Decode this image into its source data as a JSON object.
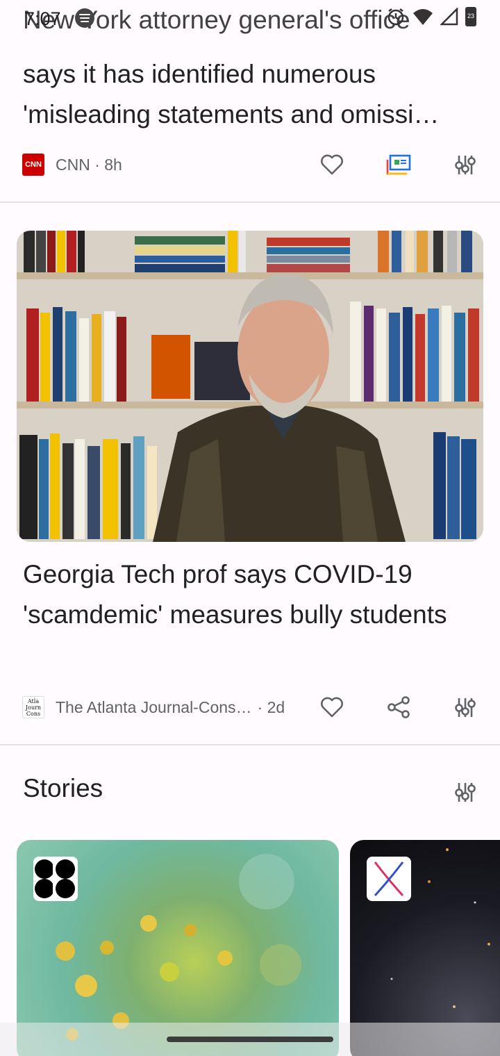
{
  "status_bar": {
    "time": "7:07",
    "icons": [
      "spotify-icon",
      "alarm-icon",
      "wifi-icon",
      "signal-icon",
      "battery-icon"
    ],
    "battery_level": "23"
  },
  "card1": {
    "headline_top": "New York attorney general's office",
    "headline_line2": "says it has identified numerous",
    "headline_line3": "'misleading statements and omissi…",
    "source_logo_text": "CNN",
    "source": "CNN · 8h"
  },
  "card2": {
    "image_desc_icon": "hero-photo",
    "headline": "Georgia Tech prof says COVID-19 'scamdemic' measures bully students",
    "source_logo_text": "Atla Journ Cons",
    "source": "The Atlanta Journal-Cons…",
    "age": "· 2d"
  },
  "stories": {
    "title": "Stories"
  },
  "colors": {
    "cnn_red": "#cc0000",
    "text": "#202124",
    "meta": "#5f6368"
  }
}
